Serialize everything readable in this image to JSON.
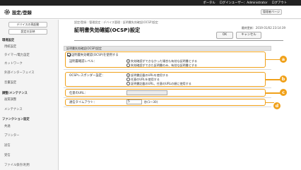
{
  "topbar": {
    "portal_link": "ポータル",
    "login_user": "ログインユーザー：Administrator",
    "logout": "ログアウト"
  },
  "appbar": {
    "title": "設定/登録",
    "portal_button": "管理者ページ",
    "icon": "settings-gear-icon"
  },
  "sidebar": {
    "device_status_button": "デバイスの再起動",
    "apply_settings_button": "設定の反映",
    "sections": [
      {
        "label": "環境設定",
        "items": [
          "用紙設定",
          "タイマー/電力設定",
          "ネットワーク",
          "外部インターフェイス",
          "音量設定"
        ]
      },
      {
        "label": "調整/メンテナンス",
        "items": [
          "画質調整",
          "メンテナンス"
        ]
      },
      {
        "label": "ファンクション設定",
        "items": [
          "共通",
          "プリンター",
          "送信",
          "受信",
          "ファイル保存/利用"
        ]
      }
    ]
  },
  "main": {
    "breadcrumb": "設定/登録 : 管理設定 : デバイス管理 : 証明書失効確認(OCSP)設定",
    "title": "証明書失効確認(OCSP)設定",
    "last_updated": "最終更新：2019 01/02 23:14:39",
    "ok_button": "OK",
    "cancel_button": "キャンセル",
    "section_header": "証明書失効確認(OCSP)設定",
    "use_ocsp_label": "証明書失効確認(OCSP)を使用する",
    "use_ocsp_checked": true,
    "verify_level_label": "証明書確認レベル：",
    "verify_level_options": [
      "失効確認ができなかった場合も有効な証明書とする",
      "失効確認ができた証明書のみ、有効な証明書とする"
    ],
    "verify_level_selected": 0,
    "responder_label": "OCSPレスポンダー設定：",
    "responder_options": [
      "証明書記載のURLを使用する",
      "任意のURLを使用する",
      "証明書記載のURL、任意のURLの順に使用する"
    ],
    "responder_selected": 0,
    "custom_url_label": "任意のURL：",
    "custom_url_value": "",
    "timeout_label": "通信タイムアウト：",
    "timeout_value": "5",
    "timeout_unit": "秒(1～30)"
  },
  "callouts": [
    "a",
    "b",
    "c",
    "d"
  ],
  "colors": {
    "accent": "#f0a11a",
    "topbar": "#222222",
    "sidebar": "#f4f4f4"
  }
}
